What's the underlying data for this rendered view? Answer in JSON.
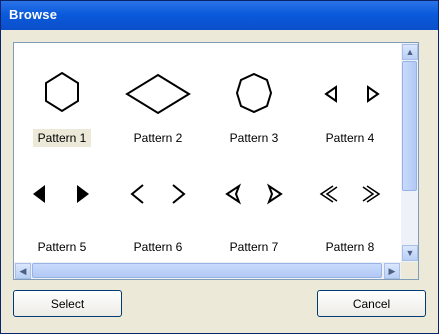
{
  "window": {
    "title": "Browse"
  },
  "patterns": [
    {
      "label": "Pattern 1",
      "icon": "hexagon-icon",
      "selected": true
    },
    {
      "label": "Pattern 2",
      "icon": "diamond-icon",
      "selected": false
    },
    {
      "label": "Pattern 3",
      "icon": "rounded-hexagon-icon",
      "selected": false
    },
    {
      "label": "Pattern 4",
      "icon": "small-open-triangles-icon",
      "selected": false
    },
    {
      "label": "Pattern 5",
      "icon": "filled-triangles-icon",
      "selected": false
    },
    {
      "label": "Pattern 6",
      "icon": "chevrons-icon",
      "selected": false
    },
    {
      "label": "Pattern 7",
      "icon": "notched-triangles-icon",
      "selected": false
    },
    {
      "label": "Pattern 8",
      "icon": "double-chevrons-icon",
      "selected": false
    }
  ],
  "buttons": {
    "select_label": "Select",
    "cancel_label": "Cancel"
  },
  "colors": {
    "titlebar": "#0a5adc",
    "panel_border": "#7f9db9",
    "selected_label_bg": "#ece9d8"
  }
}
